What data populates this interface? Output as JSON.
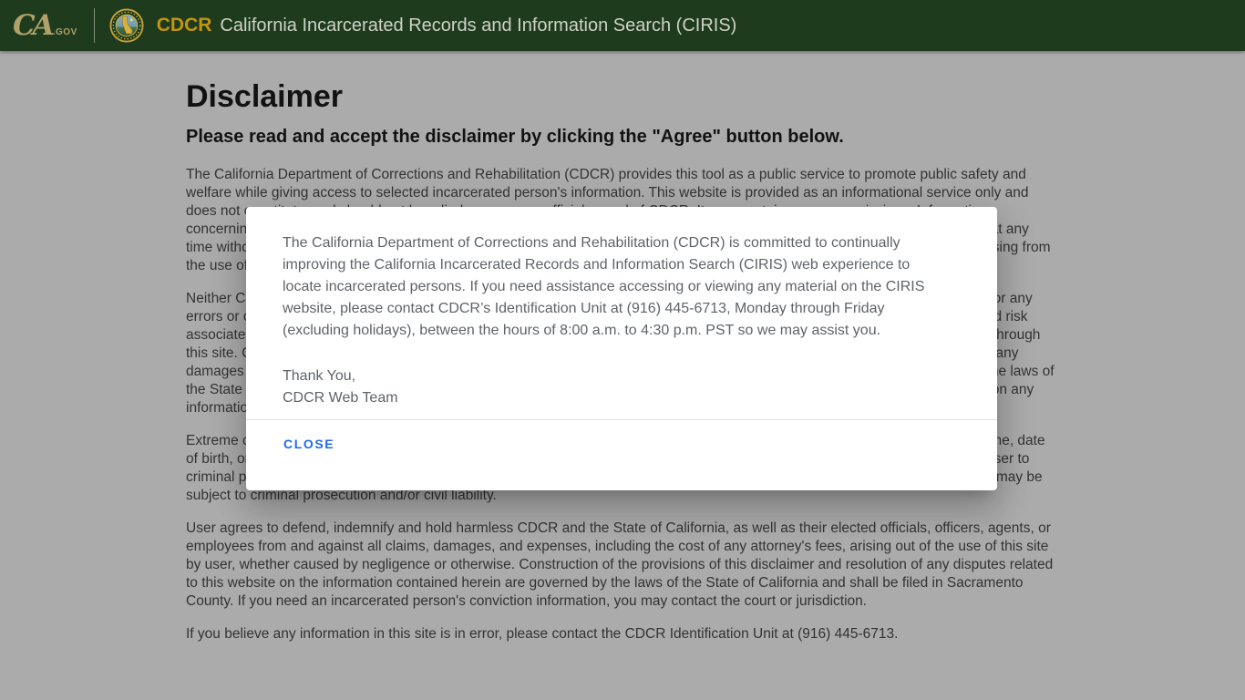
{
  "header": {
    "logo_ca": "CA",
    "logo_gov": ".GOV",
    "seal_icon": "cdcr-circular-seal",
    "brand": "CDCR",
    "title": "California Incarcerated Records and Information Search (CIRIS)"
  },
  "page": {
    "heading": "Disclaimer",
    "subheading": "Please read and accept the disclaimer by clicking the \"Agree\" button below.",
    "paragraphs": {
      "p1": "The California Department of Corrections and Rehabilitation (CDCR) provides this tool as a public service to promote public safety and welfare while giving access to selected incarcerated person's information. This website is provided as an informational service only and does not constitute, and should not be relied upon as, an official record of CDCR. It may contain errors or omissions. Information concerning custody status, location, scheduled release dates, the county, admitted offenses, and other case factors may change at any time without notice. CDCR makes no guarantee that the information is accurate, complete, or current, and assumes no liability arising from the use of any information in this website.",
      "p2": "Neither CDCR nor the State of California warrants the accuracy or completeness of this information and shall not be responsible for any errors or omissions on this website or any site linked herein. By accessing this website, the user shall assume all responsibility and risk associated with its use and reliance on its content. Except with the consent of the user, may no personal information be collected through this site. CDCR and the State of California, as well as their elected officials, officers, agents, and employees shall not be liable for any damages or losses of any kind arising out of the use of, or the inability to use, this website. This disclaimer shall be governed by the laws of the State of California, and any equitable or legal action concerning this website shall be filed in Sacramento County. Reliance upon any information contained herein is at the user's sole risk.",
      "p3": "Extreme care should be used when attempting to identify a person using this website. Identifications made relying solely upon name, date of birth, or other identifying data are discouraged. Unauthorized use of the information contained in this website may subject the user to criminal prosecution and/or civil liability.Unauthorized attempts to change the information in this website are strictly prohibited and may be subject to criminal prosecution and/or civil liability.",
      "p4": "User agrees to defend, indemnify and hold harmless CDCR and the State of California, as well as their elected officials, officers, agents, or employees from and against all claims, damages, and expenses, including the cost of any attorney's fees, arising out of the use of this site by user, whether caused by negligence or otherwise. Construction of the provisions of this disclaimer and resolution of any disputes related to this website on the information contained herein are governed by the laws of the State of California and shall be filed in Sacramento County. If you need an incarcerated person's conviction information, you may contact the court or jurisdiction.",
      "p5": "If you believe any information in this site is in error, please contact the CDCR Identification Unit at (916) 445-6713."
    }
  },
  "dialog": {
    "message": "The California Department of Corrections and Rehabilitation (CDCR) is committed to continually improving the California Incarcerated Records and Information Search (CIRIS) web experience to locate incarcerated persons. If you need assistance accessing or viewing any material on the CIRIS website, please contact CDCR’s Identification Unit at (916) 445-6713, Monday through Friday (excluding holidays), between the hours of 8:00 a.m. to 4:30 p.m. PST so we may assist you.",
    "closing": "Thank You,",
    "signature": "CDCR Web Team",
    "close_label": "CLOSE"
  },
  "colors": {
    "header_bg": "#1e3b1e",
    "brand_gold": "#c4940f",
    "logo_tan": "#b2a169",
    "header_title": "#ced2c4",
    "close_blue": "#2169e8",
    "seal_ring_gold": "#c9a23a"
  }
}
